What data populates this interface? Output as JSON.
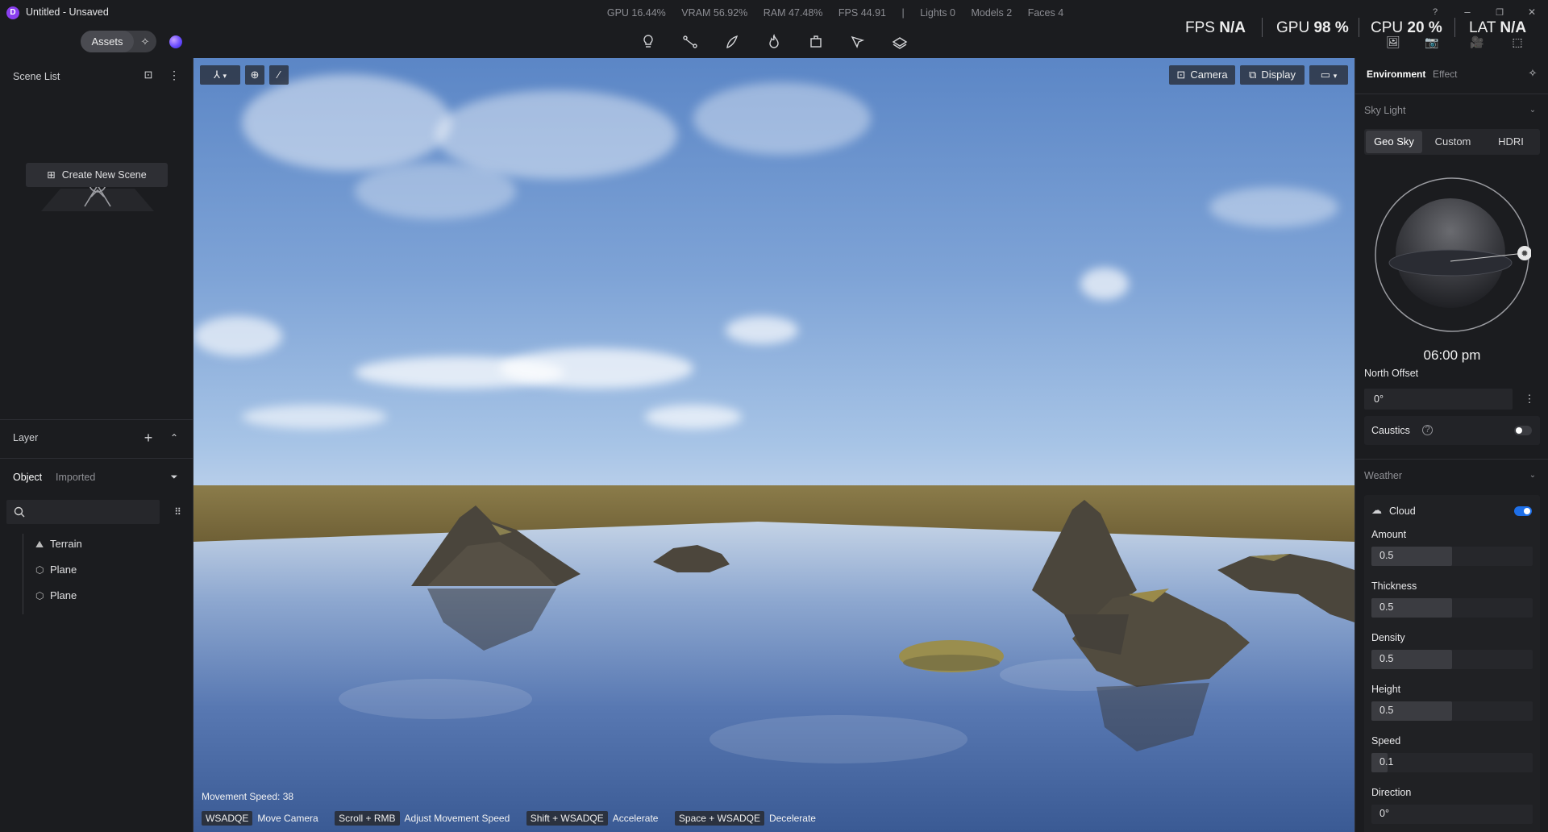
{
  "window": {
    "title": "Untitled - Unsaved",
    "logo_letter": "D",
    "controls": {
      "help": "?",
      "minimize": "–",
      "restore": "❐",
      "close": "✕"
    }
  },
  "stats_bar": {
    "gpu": "GPU 16.44%",
    "vram": "VRAM 56.92%",
    "ram": "RAM 47.48%",
    "fps": "FPS 44.91",
    "separator": "|",
    "lights": "Lights 0",
    "models": "Models 2",
    "faces": "Faces 4"
  },
  "perf_overlay": {
    "fps_label": "FPS",
    "fps_value": "N/A",
    "gpu_label": "GPU",
    "gpu_value": "98 %",
    "cpu_label": "CPU",
    "cpu_value": "20 %",
    "lat_label": "LAT",
    "lat_value": "N/A"
  },
  "toolbar": {
    "assets_label": "Assets",
    "tools": [
      "lightbulb-icon",
      "path-icon",
      "brush-icon",
      "fire-icon",
      "crop-box-icon",
      "cursor-select-icon",
      "layers-icon"
    ],
    "right_tools": [
      "image-icon",
      "camera-icon",
      "video-icon",
      "render-icon"
    ]
  },
  "scene_list": {
    "title": "Scene List",
    "create_label": "Create New Scene"
  },
  "layer_panel": {
    "title": "Layer",
    "tabs": [
      "Object",
      "Imported"
    ],
    "search_placeholder": "",
    "items": [
      {
        "icon": "terrain-icon",
        "label": "Terrain"
      },
      {
        "icon": "cube-icon",
        "label": "Plane"
      },
      {
        "icon": "cube-icon",
        "label": "Plane"
      }
    ]
  },
  "viewport": {
    "camera_label": "Camera",
    "display_label": "Display",
    "movement_speed": "Movement Speed: 38",
    "shortcuts": [
      {
        "key": "WSADQE",
        "desc": "Move Camera"
      },
      {
        "key": "Scroll + RMB",
        "desc": "Adjust Movement Speed"
      },
      {
        "key": "Shift + WSADQE",
        "desc": "Accelerate"
      },
      {
        "key": "Space + WSADQE",
        "desc": "Decelerate"
      }
    ]
  },
  "right_panel": {
    "tabs": [
      "Environment",
      "Effect"
    ],
    "sky_light": {
      "title": "Sky Light",
      "modes": [
        "Geo Sky",
        "Custom",
        "HDRI"
      ],
      "selected_mode": "Geo Sky",
      "time": "06:00 pm",
      "north_offset_label": "North Offset",
      "north_offset_value": "0°",
      "caustics_label": "Caustics",
      "caustics_enabled": false
    },
    "weather": {
      "title": "Weather",
      "cloud_label": "Cloud",
      "cloud_enabled": true,
      "params": [
        {
          "label": "Amount",
          "value": "0.5",
          "fraction": 0.5
        },
        {
          "label": "Thickness",
          "value": "0.5",
          "fraction": 0.5
        },
        {
          "label": "Density",
          "value": "0.5",
          "fraction": 0.5
        },
        {
          "label": "Height",
          "value": "0.5",
          "fraction": 0.5
        },
        {
          "label": "Speed",
          "value": "0.1",
          "fraction": 0.1
        },
        {
          "label": "Direction",
          "value": "0°",
          "fraction": 0
        }
      ]
    }
  },
  "colors": {
    "accent": "#1e6fe8",
    "panel_bg": "#1b1c1f",
    "logo": "#8a3ff0"
  }
}
